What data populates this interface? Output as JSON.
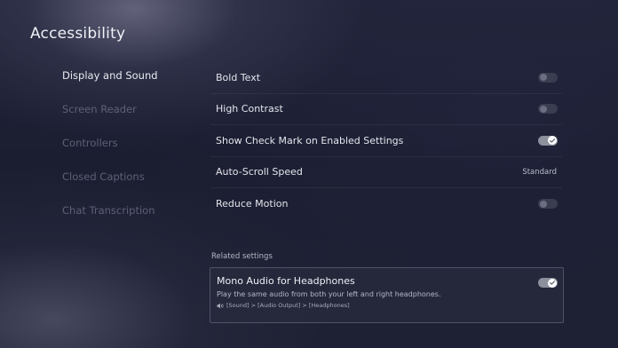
{
  "page_title": "Accessibility",
  "nav": {
    "items": [
      {
        "label": "Display and Sound",
        "active": true
      },
      {
        "label": "Screen Reader",
        "active": false
      },
      {
        "label": "Controllers",
        "active": false
      },
      {
        "label": "Closed Captions",
        "active": false
      },
      {
        "label": "Chat Transcription",
        "active": false
      }
    ]
  },
  "settings": [
    {
      "label": "Bold Text",
      "control": "toggle",
      "on": false
    },
    {
      "label": "High Contrast",
      "control": "toggle",
      "on": false
    },
    {
      "label": "Show Check Mark on Enabled Settings",
      "control": "toggle",
      "on": true
    },
    {
      "label": "Auto-Scroll Speed",
      "control": "value",
      "value": "Standard"
    },
    {
      "label": "Reduce Motion",
      "control": "toggle",
      "on": false
    }
  ],
  "related": {
    "heading": "Related settings",
    "title": "Mono Audio for Headphones",
    "description": "Play the same audio from both your left and right headphones.",
    "path_icon": "speaker-icon",
    "path": "[Sound] > [Audio Output] > [Headphones]",
    "on": true
  },
  "colors": {
    "background": "#1e2034",
    "toggle_on": "#8c8f9c",
    "toggle_off": "#3a3d4f",
    "inactive_text": "#5d6177"
  }
}
